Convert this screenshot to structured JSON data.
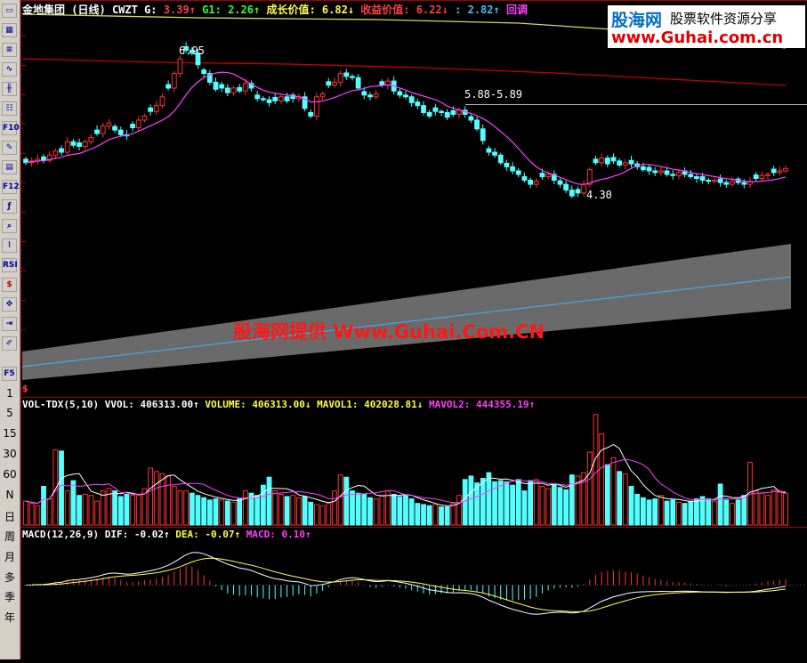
{
  "header": {
    "stock": "金地集团",
    "period": "(日线)",
    "indicator": "CWZT",
    "g_label": "G:",
    "g_value": "3.39",
    "g1_label": "G1:",
    "g1_value": "2.26",
    "growth_label": "成长价值:",
    "growth_value": "6.82",
    "profit_label": "收益价值:",
    "profit_value": "6.22",
    "colon_label": ":",
    "colon_value": "2.82",
    "pullback_label": "回调"
  },
  "price_labels": {
    "high": "6.95",
    "range": "5.88-5.89",
    "low": "4.30"
  },
  "currency_mark": "$",
  "volume_header": {
    "name": "VOL-TDX(5,10)",
    "vvol_label": "VVOL:",
    "vvol_value": "406313.00",
    "volume_label": "VOLUME:",
    "volume_value": "406313.00",
    "mavol1_label": "MAVOL1:",
    "mavol1_value": "402028.81",
    "mavol2_label": "MAVOL2:",
    "mavol2_value": "444355.19"
  },
  "macd_header": {
    "name": "MACD(12,26,9)",
    "dif_label": "DIF:",
    "dif_value": "-0.02",
    "dea_label": "DEA:",
    "dea_value": "-0.07",
    "macd_label": "MACD:",
    "macd_value": "0.10"
  },
  "logo": {
    "brand": "股海网",
    "slogan": "股票软件资源分享",
    "url": "www.Guhai.com.cn"
  },
  "watermark": "股海网提供 Www.Guhai.Com.CN",
  "toolbar": {
    "icons": [
      "window-icon",
      "grid-icon",
      "list-icon",
      "line-chart-icon",
      "candle-icon",
      "table-icon",
      "f10-icon",
      "note-icon",
      "doc-icon",
      "f12-icon",
      "formula-icon",
      "search-icon",
      "indicator-icon",
      "rsi-icon",
      "dollar-icon",
      "move-icon",
      "exit-icon",
      "pencil-icon",
      "f5-icon"
    ],
    "rsi_label": "RSI",
    "f10_label": "F10",
    "f12_label": "F12",
    "f5_label": "F5",
    "periods": [
      "1",
      "5",
      "15",
      "30",
      "60",
      "N",
      "日",
      "周",
      "月",
      "多",
      "季",
      "年"
    ]
  },
  "colors": {
    "up": "#ff3232",
    "down": "#54ffff",
    "ma_purple": "#ff40ff",
    "ma_yellow": "#ffff60",
    "red_line": "#c80000",
    "channel": "#707070",
    "channel_line": "#3cb4ff"
  },
  "chart_data": {
    "type": "candlestick",
    "closes": [
      4.92,
      4.95,
      4.98,
      4.96,
      5.05,
      5.12,
      5.1,
      5.28,
      5.22,
      5.2,
      5.28,
      5.35,
      5.42,
      5.55,
      5.6,
      5.48,
      5.4,
      5.38,
      5.52,
      5.65,
      5.72,
      5.8,
      5.9,
      6.05,
      6.2,
      6.45,
      6.7,
      6.85,
      6.8,
      6.6,
      6.45,
      6.3,
      6.18,
      6.2,
      6.12,
      6.2,
      6.15,
      6.28,
      6.2,
      6.02,
      6.0,
      5.95,
      5.98,
      6.05,
      5.98,
      6.02,
      6.05,
      5.85,
      5.72,
      6.05,
      6.1,
      6.25,
      6.3,
      6.45,
      6.4,
      6.38,
      6.2,
      6.08,
      6.05,
      6.1,
      6.25,
      6.32,
      6.15,
      6.08,
      6.05,
      5.95,
      5.9,
      5.78,
      5.72,
      5.8,
      5.78,
      5.7,
      5.75,
      5.82,
      5.75,
      5.65,
      5.5,
      5.3,
      5.1,
      5.05,
      4.92,
      4.85,
      4.78,
      4.72,
      4.62,
      4.55,
      4.6,
      4.68,
      4.72,
      4.62,
      4.55,
      4.45,
      4.35,
      4.4,
      4.55,
      4.8,
      4.92,
      5.0,
      4.9,
      4.95,
      4.88,
      4.92,
      4.9,
      4.85,
      4.8,
      4.78,
      4.75,
      4.78,
      4.72,
      4.7,
      4.75,
      4.72,
      4.68,
      4.65,
      4.62,
      4.6,
      4.62,
      4.58,
      4.55,
      4.6,
      4.58,
      4.55,
      4.6,
      4.65,
      4.7,
      4.72,
      4.75,
      4.78,
      4.82
    ],
    "volumes": [
      210,
      190,
      170,
      340,
      230,
      660,
      650,
      300,
      390,
      260,
      270,
      260,
      210,
      300,
      320,
      300,
      250,
      270,
      260,
      260,
      320,
      500,
      470,
      450,
      430,
      340,
      300,
      300,
      280,
      260,
      240,
      220,
      230,
      220,
      210,
      200,
      230,
      300,
      280,
      260,
      350,
      420,
      300,
      270,
      250,
      260,
      240,
      250,
      200,
      180,
      170,
      190,
      300,
      440,
      420,
      300,
      280,
      270,
      240,
      230,
      260,
      300,
      270,
      250,
      260,
      230,
      190,
      180,
      170,
      180,
      160,
      160,
      190,
      260,
      400,
      430,
      370,
      410,
      460,
      380,
      390,
      380,
      350,
      400,
      300,
      390,
      400,
      340,
      320,
      360,
      330,
      310,
      440,
      430,
      460,
      640,
      970,
      800,
      530,
      590,
      470,
      450,
      340,
      270,
      240,
      220,
      230,
      260,
      210,
      220,
      200,
      190,
      210,
      230,
      250,
      230,
      210,
      360,
      220,
      190,
      220,
      260,
      550,
      300,
      280,
      260,
      310,
      300,
      280
    ],
    "volume_ylim": [
      0,
      1000
    ],
    "price_ylim": [
      4.2,
      7.1
    ]
  }
}
